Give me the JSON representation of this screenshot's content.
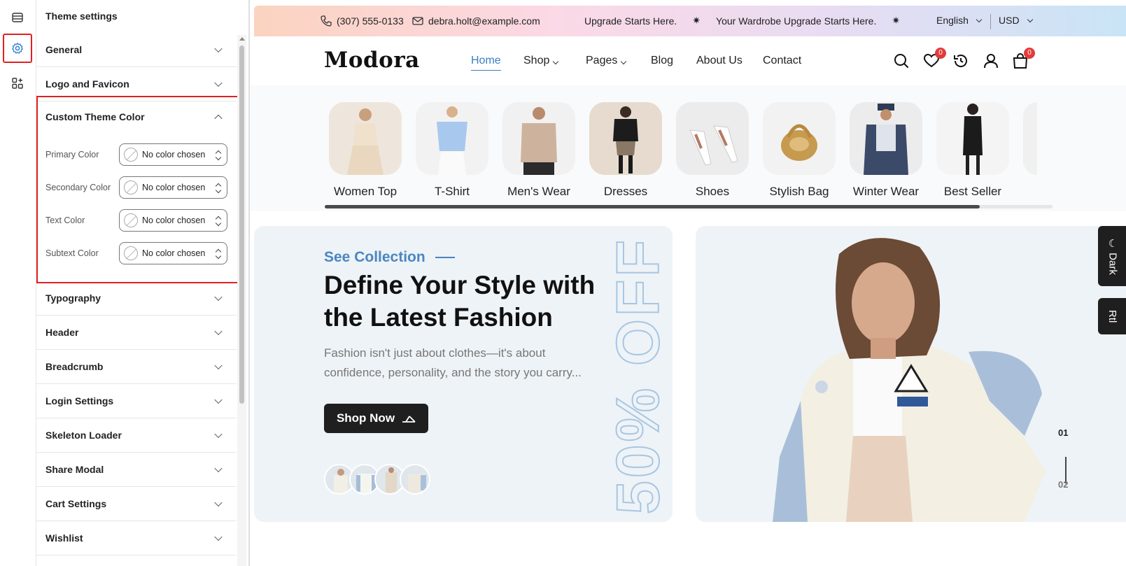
{
  "sidebar": {
    "title": "Theme settings",
    "sections": [
      {
        "label": "General"
      },
      {
        "label": "Logo and Favicon"
      },
      {
        "label": "Custom Theme Color"
      },
      {
        "label": "Typography"
      },
      {
        "label": "Header"
      },
      {
        "label": "Breadcrumb"
      },
      {
        "label": "Login Settings"
      },
      {
        "label": "Skeleton Loader"
      },
      {
        "label": "Share Modal"
      },
      {
        "label": "Cart Settings"
      },
      {
        "label": "Wishlist"
      }
    ],
    "colors": [
      {
        "label": "Primary Color",
        "value": "No color chosen"
      },
      {
        "label": "Secondary Color",
        "value": "No color chosen"
      },
      {
        "label": "Text Color",
        "value": "No color chosen"
      },
      {
        "label": "Subtext Color",
        "value": "No color chosen"
      }
    ]
  },
  "topbar": {
    "phone": "(307) 555-0133",
    "email": "debra.holt@example.com",
    "ticker_1": "Upgrade Starts Here.",
    "ticker_2": "Your Wardrobe Upgrade Starts Here.",
    "language": "English",
    "currency": "USD"
  },
  "nav": {
    "logo": "Modora",
    "links": [
      "Home",
      "Shop",
      "Pages",
      "Blog",
      "About Us",
      "Contact"
    ],
    "wishlist_count": "0",
    "cart_count": "0"
  },
  "categories": [
    "Women Top",
    "T-Shirt",
    "Men's Wear",
    "Dresses",
    "Shoes",
    "Stylish Bag",
    "Winter Wear",
    "Best Seller"
  ],
  "category_scroll_fraction": 0.9,
  "hero": {
    "kicker": "See Collection",
    "headline": "Define Your Style with the Latest Fashion",
    "subtext": "Fashion isn't just about clothes—it's about confidence, personality, and the story you carry...",
    "button": "Shop Now",
    "offer": "50% OFF",
    "slide_current": "01",
    "slide_next": "02"
  },
  "side_tabs": {
    "dark": "Dark",
    "rtl": "Rtl"
  },
  "colors": {
    "accent": "#3b7fbf",
    "highlight_border": "#e02020",
    "badge": "#e23b3b",
    "dark_button": "#1f1f1f"
  }
}
